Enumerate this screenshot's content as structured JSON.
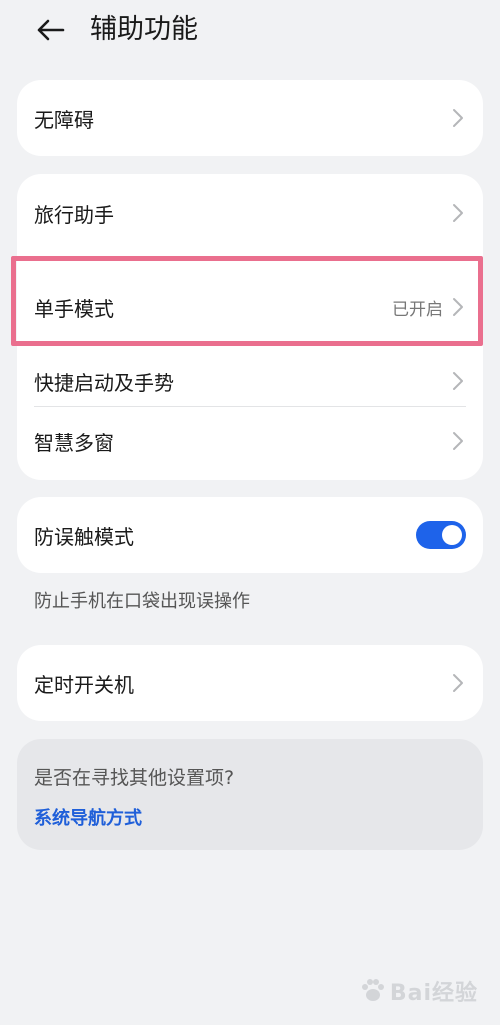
{
  "header": {
    "title": "辅助功能"
  },
  "groups": {
    "accessibility": {
      "label": "无障碍"
    },
    "travel": {
      "label": "旅行助手"
    },
    "one_hand": {
      "label": "单手模式",
      "value": "已开启"
    },
    "shortcut": {
      "label": "快捷启动及手势"
    },
    "multi_window": {
      "label": "智慧多窗"
    },
    "pocket_mode": {
      "label": "防误触模式",
      "enabled": true
    },
    "pocket_note": "防止手机在口袋出现误操作",
    "scheduled_power": {
      "label": "定时开关机"
    }
  },
  "suggestion": {
    "question": "是否在寻找其他设置项?",
    "link": "系统导航方式"
  },
  "watermark": {
    "text": "Bai经验"
  },
  "colors": {
    "accent": "#1e63ea",
    "highlight": "#ea6f8e",
    "background": "#f1f2f4"
  }
}
